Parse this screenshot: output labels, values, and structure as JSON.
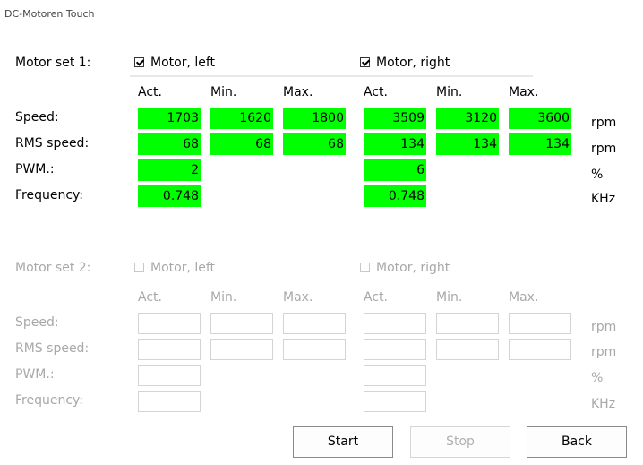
{
  "window": {
    "title": "DC-Motoren Touch"
  },
  "set1": {
    "label": "Motor set 1:",
    "left_label": "Motor, left",
    "right_label": "Motor, right",
    "headers": [
      "Act.",
      "Min.",
      "Max."
    ],
    "rows": [
      "Speed:",
      "RMS speed:",
      "PWM.:",
      "Frequency:"
    ],
    "units": [
      "rpm",
      "rpm",
      "%",
      "KHz"
    ],
    "left": {
      "speed": [
        "1703",
        "1620",
        "1800"
      ],
      "rms": [
        "68",
        "68",
        "68"
      ],
      "pwm": "2",
      "freq": "0.748"
    },
    "right": {
      "speed": [
        "3509",
        "3120",
        "3600"
      ],
      "rms": [
        "134",
        "134",
        "134"
      ],
      "pwm": "6",
      "freq": "0.748"
    }
  },
  "set2": {
    "label": "Motor set 2:",
    "left_label": "Motor, left",
    "right_label": "Motor, right",
    "headers": [
      "Act.",
      "Min.",
      "Max."
    ],
    "rows": [
      "Speed:",
      "RMS speed:",
      "PWM.:",
      "Frequency:"
    ],
    "units": [
      "rpm",
      "rpm",
      "%",
      "KHz"
    ]
  },
  "buttons": {
    "start": "Start",
    "stop": "Stop",
    "back": "Back"
  },
  "colors": {
    "active_field": "#00ff00"
  }
}
